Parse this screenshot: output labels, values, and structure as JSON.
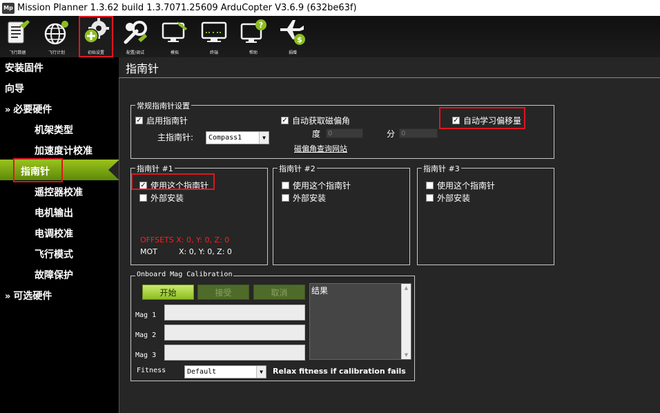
{
  "window": {
    "app_icon": "Mp",
    "title": "Mission Planner 1.3.62 build 1.3.7071.25609 ArduCopter V3.6.9 (632be63f)"
  },
  "toolbar": {
    "items": [
      {
        "label": "飞行数据",
        "icon": "flight-data-icon"
      },
      {
        "label": "飞行计划",
        "icon": "flight-plan-icon"
      },
      {
        "label": "初始设置",
        "icon": "initial-setup-icon"
      },
      {
        "label": "配置/调试",
        "icon": "config-tuning-icon"
      },
      {
        "label": "模拟",
        "icon": "simulation-icon"
      },
      {
        "label": "终端",
        "icon": "terminal-icon"
      },
      {
        "label": "帮助",
        "icon": "help-icon"
      },
      {
        "label": "捐赠",
        "icon": "donate-icon"
      }
    ]
  },
  "sidebar": {
    "install_firmware": "安装固件",
    "wizard": "向导",
    "mandatory": "必要硬件",
    "frame_type": "机架类型",
    "accel_calibration": "加速度计校准",
    "compass": "指南针",
    "radio_calibration": "遥控器校准",
    "motor_output": "电机输出",
    "esc_calibration": "电调校准",
    "flight_modes": "飞行模式",
    "failsafe": "故障保护",
    "optional": "可选硬件",
    "chevron": "»"
  },
  "page": {
    "title": "指南针"
  },
  "general": {
    "legend": "常规指南针设置",
    "enable_compass": "启用指南针",
    "auto_declination": "自动获取磁偏角",
    "auto_learn_offsets": "自动学习偏移量",
    "primary_label": "主指南针:",
    "primary_value": "Compass1",
    "degree_label": "度",
    "degree_value": "0",
    "minute_label": "分",
    "minute_value": "0",
    "declination_link": "磁偏角查询网站"
  },
  "compass1": {
    "legend": "指南针 #1",
    "use_this": "使用这个指南针",
    "external": "外部安装",
    "offsets": "OFFSETS  X: 0,   Y: 0,   Z: 0",
    "mot_label": "MOT",
    "mot_values": "X: 0,   Y: 0,   Z: 0"
  },
  "compass2": {
    "legend": "指南针 #2",
    "use_this": "使用这个指南针",
    "external": "外部安装"
  },
  "compass3": {
    "legend": "指南针 #3",
    "use_this": "使用这个指南针",
    "external": "外部安装"
  },
  "onboard": {
    "legend": "Onboard Mag Calibration",
    "start": "开始",
    "accept": "接受",
    "cancel": "取消",
    "results_label": "结果",
    "mag1": "Mag 1",
    "mag2": "Mag 2",
    "mag3": "Mag 3",
    "fitness_label": "Fitness",
    "fitness_value": "Default",
    "relax": "Relax fitness if calibration fails"
  },
  "colors": {
    "accent_green": "#8cbd23",
    "highlight_red": "#e0151f",
    "offsets_red": "#ff1e1e"
  }
}
